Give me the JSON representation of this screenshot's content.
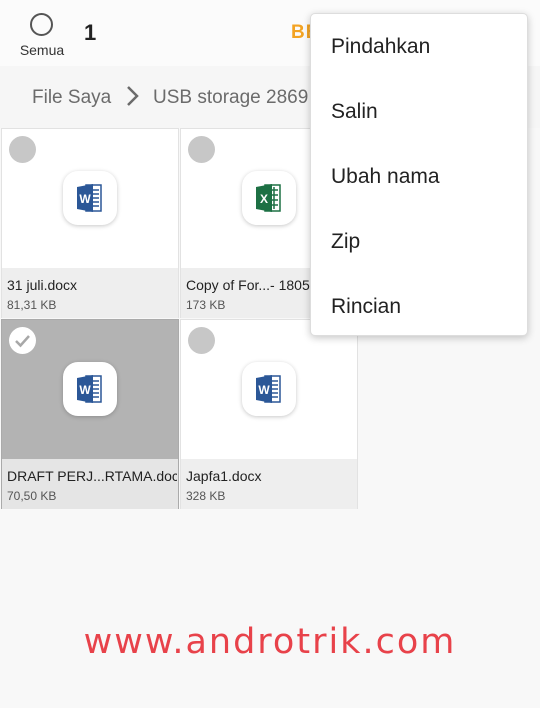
{
  "header": {
    "select_all_label": "Semua",
    "selected_count": "1",
    "share_label": "BE"
  },
  "breadcrumb": {
    "root": "File Saya",
    "current": "USB storage 2869"
  },
  "files": [
    {
      "name": "31 juli.docx",
      "size": "81,31 KB",
      "type": "word",
      "selected": false
    },
    {
      "name": "Copy of For...- 1805",
      "size": "173 KB",
      "type": "excel",
      "selected": false
    },
    {
      "name": "DRAFT PERJ...RTAMA.docx",
      "size": "70,50 KB",
      "type": "word",
      "selected": true
    },
    {
      "name": "Japfa1.docx",
      "size": "328 KB",
      "type": "word",
      "selected": false
    }
  ],
  "menu": {
    "items": [
      "Pindahkan",
      "Salin",
      "Ubah nama",
      "Zip",
      "Rincian"
    ]
  },
  "watermark": "www.androtrik.com",
  "colors": {
    "accent": "#f3a323",
    "word_blue": "#2b5797",
    "excel_green": "#1d7044",
    "watermark_red": "#e8424a"
  }
}
